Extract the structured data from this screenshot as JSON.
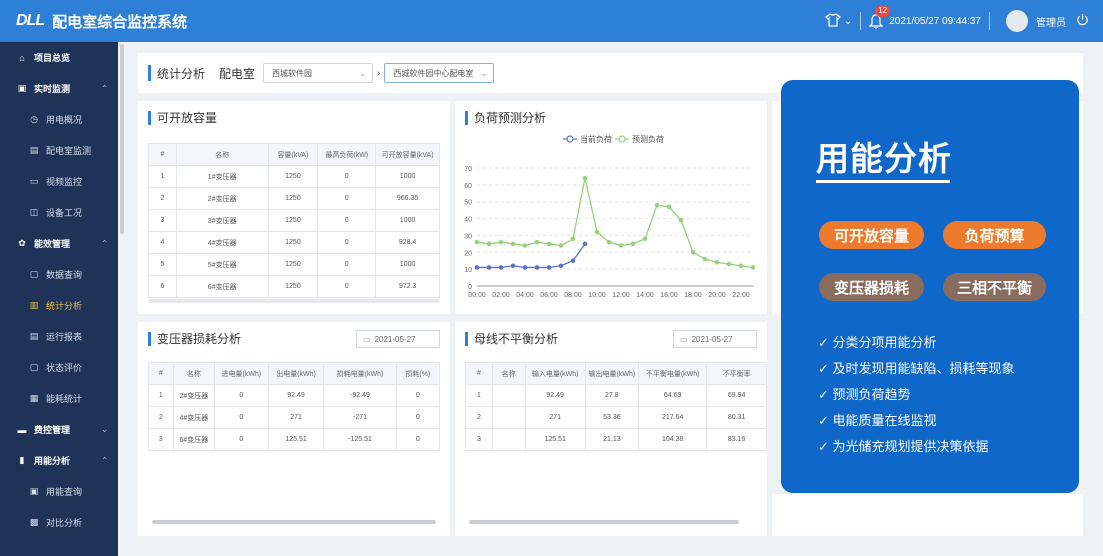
{
  "header": {
    "logo": "DLL",
    "title": "配电室综合监控系统",
    "notif_count": "12",
    "datetime": "2021/05/27 09:44:37",
    "user": "管理员"
  },
  "sidebar": {
    "items": [
      {
        "label": "项目总览",
        "icon": "home-icon",
        "group": true
      },
      {
        "label": "实时监测",
        "icon": "monitor-icon",
        "group": true,
        "chev": "^"
      },
      {
        "label": "用电概况",
        "icon": "clock-icon"
      },
      {
        "label": "配电室监测",
        "icon": "building-icon"
      },
      {
        "label": "视频监控",
        "icon": "video-icon"
      },
      {
        "label": "设备工况",
        "icon": "device-icon"
      },
      {
        "label": "能效管理",
        "icon": "gear-icon",
        "group": true,
        "chev": "^"
      },
      {
        "label": "数据查询",
        "icon": "document-icon"
      },
      {
        "label": "统计分析",
        "icon": "book-icon",
        "active": true
      },
      {
        "label": "运行报表",
        "icon": "report-icon"
      },
      {
        "label": "状态评价",
        "icon": "evaluate-icon"
      },
      {
        "label": "能耗统计",
        "icon": "stats-icon"
      },
      {
        "label": "费控管理",
        "icon": "fee-icon",
        "group": true,
        "chev": "v"
      },
      {
        "label": "用能分析",
        "icon": "barchart-icon",
        "group": true,
        "chev": "^"
      },
      {
        "label": "用能查询",
        "icon": "query-icon"
      },
      {
        "label": "对比分析",
        "icon": "compare-icon"
      }
    ]
  },
  "filter": {
    "title": "统计分析",
    "room_label": "配电室",
    "select1": "西城软件园",
    "select2": "西城软件园中心配电室"
  },
  "capacity": {
    "title": "可开放容量",
    "headers": [
      "#",
      "名称",
      "容量(kVA)",
      "最高负荷(kW)",
      "可开放容量(kVA)"
    ],
    "rows": [
      [
        "1",
        "1#变压器",
        "1250",
        "0",
        "1000"
      ],
      [
        "2",
        "2#变压器",
        "1250",
        "0",
        "966.35"
      ],
      [
        "3",
        "3#变压器",
        "1250",
        "0",
        "1000"
      ],
      [
        "4",
        "4#变压器",
        "1250",
        "0",
        "928.4"
      ],
      [
        "5",
        "5#变压器",
        "1250",
        "0",
        "1000"
      ],
      [
        "6",
        "6#变压器",
        "1250",
        "0",
        "972.3"
      ]
    ]
  },
  "forecast": {
    "title": "负荷预测分析"
  },
  "loss": {
    "title": "变压器损耗分析",
    "date": "2021-05-27",
    "headers": [
      "#",
      "名称",
      "进电量(kWh)",
      "出电量(kWh)",
      "损耗电量(kWh)",
      "损耗(%)"
    ],
    "rows": [
      [
        "1",
        "2#变压器",
        "0",
        "92.49",
        "-92.49",
        "0"
      ],
      [
        "2",
        "4#变压器",
        "0",
        "271",
        "-271",
        "0"
      ],
      [
        "3",
        "6#变压器",
        "0",
        "125.51",
        "-125.51",
        "0"
      ]
    ]
  },
  "imbalance": {
    "title": "母线不平衡分析",
    "date": "2021-05-27",
    "headers": [
      "#",
      "名称",
      "输入电量(kWh)",
      "输出电量(kWh)",
      "不平衡电量(kWh)",
      "不平衡率"
    ],
    "rows": [
      [
        "1",
        "",
        "92.49",
        "27.8",
        "64.69",
        "69.94"
      ],
      [
        "2",
        "",
        "271",
        "53.36",
        "217.64",
        "80.31"
      ],
      [
        "3",
        "",
        "125.51",
        "21.13",
        "104.38",
        "83.16"
      ]
    ]
  },
  "promo": {
    "title": "用能分析",
    "pills": [
      "可开放容量",
      "负荷预算",
      "变压器损耗",
      "三相不平衡"
    ],
    "features": [
      "✓ 分类分项用能分析",
      "✓ 及时发现用能缺陷、损耗等现象",
      "✓ 预测负荷趋势",
      "✓ 电能质量在线监视",
      "✓ 为光储充规划提供决策依据"
    ]
  },
  "colors": {
    "accent": "#2e7fd6",
    "sidebar": "#1f3358",
    "promo": "#0f67c9",
    "orange": "#ee7a2b",
    "brown": "#8a6c5e",
    "series_current": "#5b74c7",
    "series_forecast": "#96d27c"
  },
  "chart_data": {
    "type": "line",
    "legend_position": "top-center",
    "x": [
      "00:00",
      "01:00",
      "02:00",
      "03:00",
      "04:00",
      "05:00",
      "06:00",
      "07:00",
      "08:00",
      "09:00",
      "10:00",
      "11:00",
      "12:00",
      "13:00",
      "14:00",
      "15:00",
      "16:00",
      "17:00",
      "18:00",
      "19:00",
      "20:00",
      "21:00",
      "22:00",
      "23:00"
    ],
    "xticks": [
      "00:00",
      "02:00",
      "04:00",
      "06:00",
      "08:00",
      "10:00",
      "12:00",
      "14:00",
      "16:00",
      "18:00",
      "20:00",
      "22:00"
    ],
    "ylim": [
      0,
      70
    ],
    "yticks": [
      0,
      10,
      20,
      30,
      40,
      50,
      60,
      70
    ],
    "grid": true,
    "series": [
      {
        "name": "当前负荷",
        "values": [
          11,
          11,
          11,
          12,
          11,
          11,
          11,
          12,
          15,
          25,
          null,
          null,
          null,
          null,
          null,
          null,
          null,
          null,
          null,
          null,
          null,
          null,
          null,
          null
        ]
      },
      {
        "name": "预测负荷",
        "values": [
          26,
          25,
          26,
          25,
          24,
          26,
          25,
          24,
          28,
          64,
          32,
          26,
          24,
          25,
          28,
          48,
          47,
          39,
          20,
          16,
          14,
          13,
          12,
          11
        ]
      }
    ]
  }
}
